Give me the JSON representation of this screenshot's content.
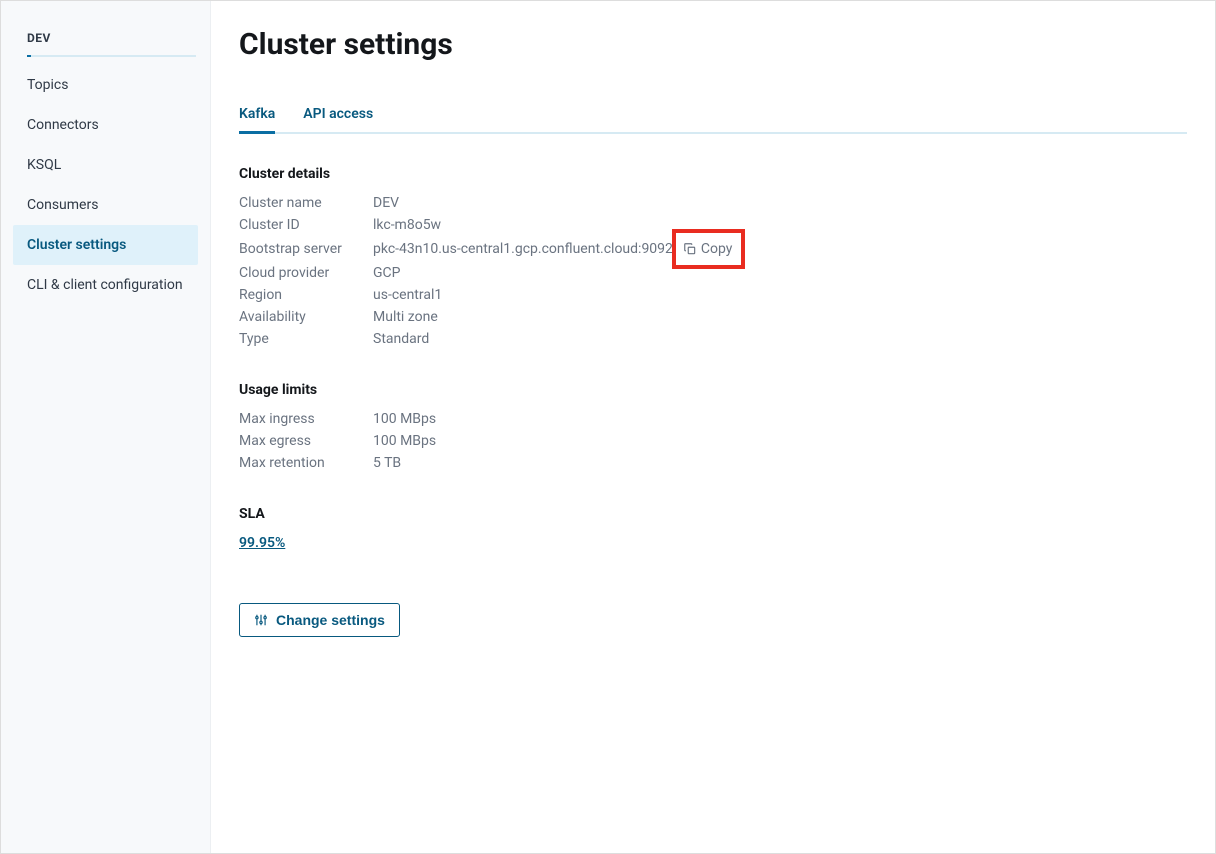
{
  "sidebar": {
    "header": "DEV",
    "items": [
      {
        "label": "Topics"
      },
      {
        "label": "Connectors"
      },
      {
        "label": "KSQL"
      },
      {
        "label": "Consumers"
      },
      {
        "label": "Cluster settings",
        "active": true
      },
      {
        "label": "CLI & client configuration"
      }
    ]
  },
  "page": {
    "title": "Cluster settings"
  },
  "tabs": [
    {
      "label": "Kafka",
      "active": true
    },
    {
      "label": "API access"
    }
  ],
  "sections": {
    "cluster_details": {
      "title": "Cluster details",
      "rows": {
        "cluster_name": {
          "label": "Cluster name",
          "value": "DEV"
        },
        "cluster_id": {
          "label": "Cluster ID",
          "value": "lkc-m8o5w"
        },
        "bootstrap_server": {
          "label": "Bootstrap server",
          "value": "pkc-43n10.us-central1.gcp.confluent.cloud:9092",
          "copy_label": "Copy"
        },
        "cloud_provider": {
          "label": "Cloud provider",
          "value": "GCP"
        },
        "region": {
          "label": "Region",
          "value": "us-central1"
        },
        "availability": {
          "label": "Availability",
          "value": "Multi zone"
        },
        "type": {
          "label": "Type",
          "value": "Standard"
        }
      }
    },
    "usage_limits": {
      "title": "Usage limits",
      "rows": {
        "max_ingress": {
          "label": "Max ingress",
          "value": "100 MBps"
        },
        "max_egress": {
          "label": "Max egress",
          "value": "100 MBps"
        },
        "max_retention": {
          "label": "Max retention",
          "value": "5 TB"
        }
      }
    },
    "sla": {
      "title": "SLA",
      "link": "99.95%"
    }
  },
  "actions": {
    "change_settings": "Change settings"
  }
}
